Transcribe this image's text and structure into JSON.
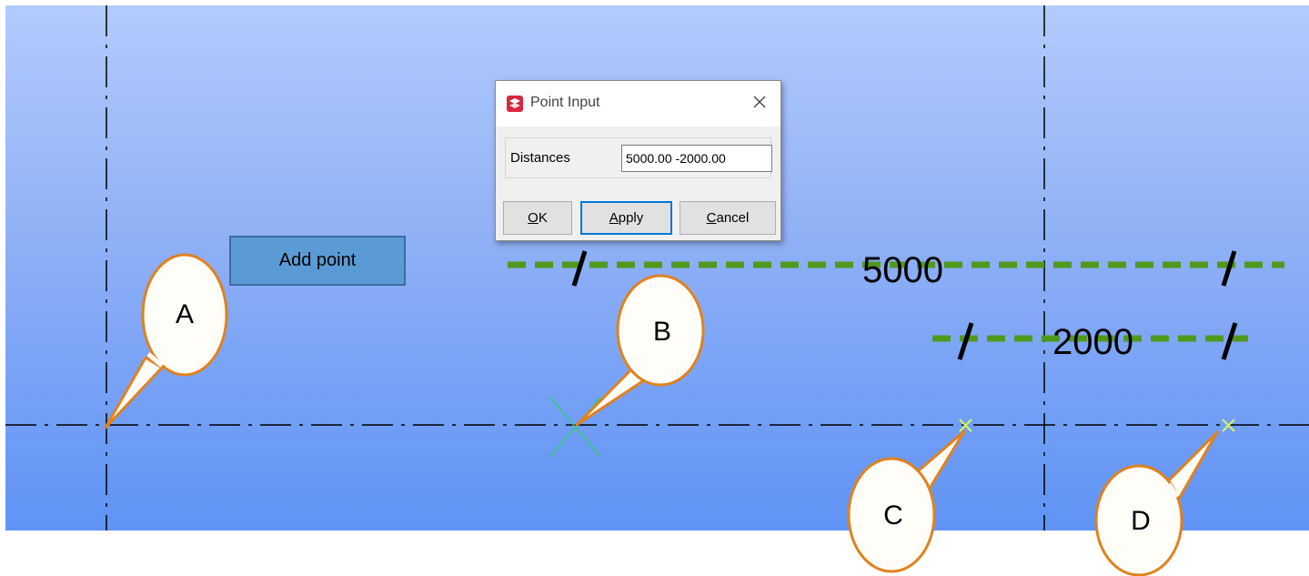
{
  "dialog": {
    "title": "Point Input",
    "field_label": "Distances",
    "field_value": "5000.00 -2000.00",
    "buttons": {
      "ok": {
        "mnemonic": "O",
        "rest": "K"
      },
      "apply": {
        "mnemonic": "A",
        "rest": "pply"
      },
      "cancel": {
        "mnemonic": "C",
        "rest": "ancel"
      }
    }
  },
  "add_point_label": "Add point",
  "callouts": {
    "a": "A",
    "b": "B",
    "c": "C",
    "d": "D"
  },
  "dimensions": {
    "horizontal": "5000",
    "vertical": "2000"
  },
  "colors": {
    "dimension_line": "#4f9a1d",
    "callout_border": "#e0821d",
    "point_marker_green": "#2ecc71",
    "point_marker_yellow": "#d7f55a",
    "add_point_fill": "#5b9bd5"
  }
}
